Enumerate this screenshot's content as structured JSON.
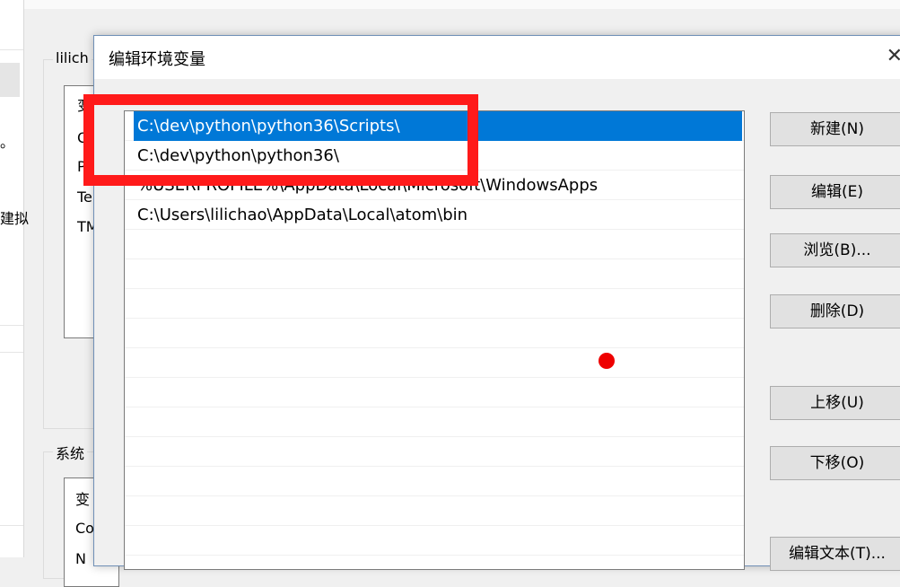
{
  "background_window": {
    "user_group_title": "lilich",
    "user_list_items": [
      "变",
      "O",
      "P",
      "Te",
      "TM"
    ],
    "system_group_title": "系统",
    "system_list_items": [
      "变",
      "Co",
      "N"
    ],
    "left_pane_items": [
      "。",
      "建拟"
    ]
  },
  "dialog": {
    "title": "编辑环境变量",
    "close_icon": "close-icon",
    "paths": [
      "C:\\dev\\python\\python36\\Scripts\\",
      "C:\\dev\\python\\python36\\",
      "%USERPROFILE%\\AppData\\Local\\Microsoft\\WindowsApps",
      "C:\\Users\\lilichao\\AppData\\Local\\atom\\bin"
    ],
    "selected_index": 0,
    "visible_partial_path_text": "soft\\WindowsApps",
    "buttons": {
      "new": "新建(N)",
      "edit": "编辑(E)",
      "browse": "浏览(B)...",
      "delete": "删除(D)",
      "move_up": "上移(U)",
      "move_down": "下移(O)",
      "edit_text": "编辑文本(T)..."
    }
  },
  "annotation": {
    "highlight_color": "#ff1a1a",
    "dot_color": "#ee0000"
  }
}
